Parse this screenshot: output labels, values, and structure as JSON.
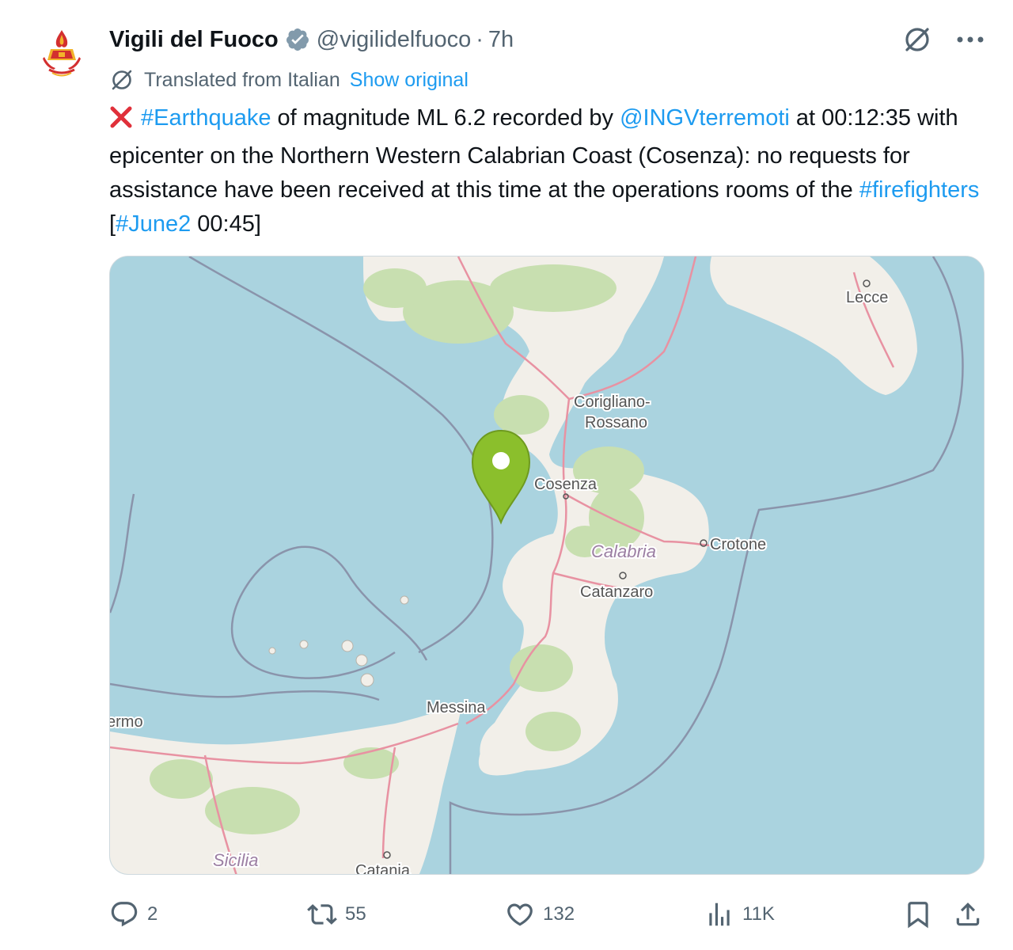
{
  "tweet": {
    "display_name": "Vigili del Fuoco",
    "handle": "@vigilidelfuoco",
    "separator": "·",
    "time": "7h",
    "verified": true,
    "translation": {
      "note": "Translated from Italian",
      "show_original_label": "Show original"
    },
    "body": {
      "emoji": "cross-mark",
      "hashtag_earthquake": "#Earthquake",
      "text1": " of magnitude ML 6.2 recorded by ",
      "mention": "@INGVterremoti",
      "text2": " at 00:12:35 with epicenter on the Northern Western Calabrian Coast (Cosenza): no requests for assistance have been received at this time at the operations rooms of the ",
      "hashtag_firefighters": "#firefighters",
      "text3": " [",
      "hashtag_date": "#June2",
      "text4": " 00:45]"
    }
  },
  "map": {
    "labels": {
      "lecce": "Lecce",
      "corigliano_1": "Corigliano-",
      "corigliano_2": "Rossano",
      "cosenza": "Cosenza",
      "calabria": "Calabria",
      "crotone": "Crotone",
      "catanzaro": "Catanzaro",
      "messina": "Messina",
      "palermo_partial": "ermo",
      "sicilia": "Sicilia",
      "catania": "Catania"
    },
    "colors": {
      "sea": "#aad3df",
      "land": "#f2efe9",
      "forest": "#c8dfb0",
      "road": "#e892a2",
      "marker": "#8bbf2c"
    }
  },
  "actions": {
    "replies": "2",
    "reposts": "55",
    "likes": "132",
    "views": "11K"
  },
  "colors": {
    "link": "#1d9bf0",
    "secondary_text": "#536471",
    "primary_text": "#0f1419",
    "verified_badge": "#829aab",
    "cross_mark": "#e0303a"
  }
}
